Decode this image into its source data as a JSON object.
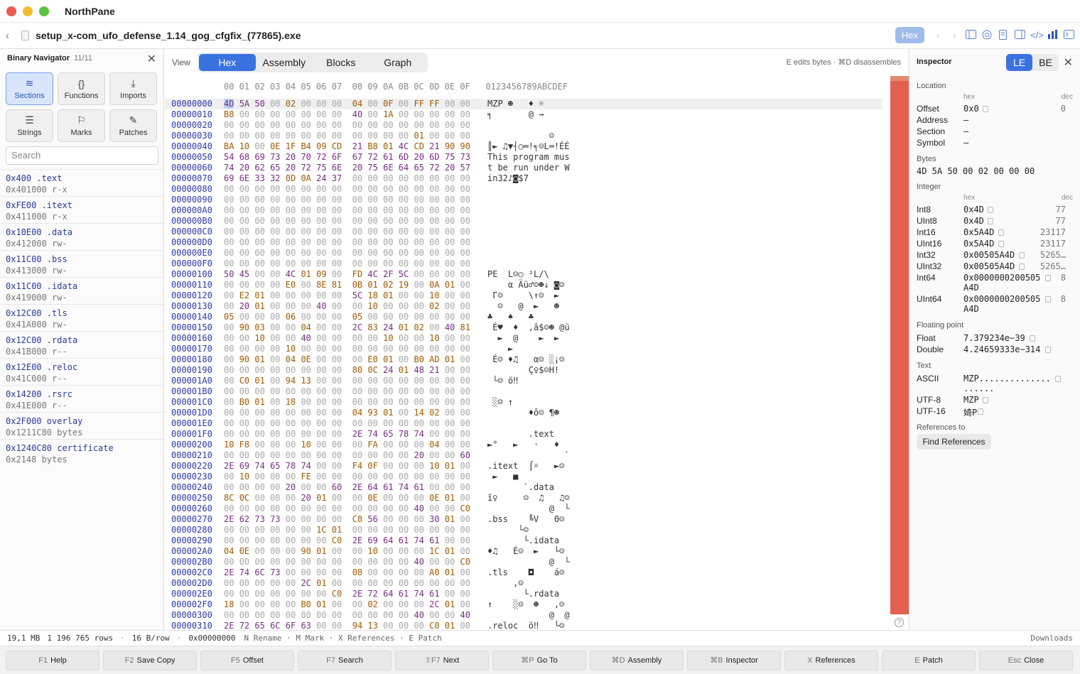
{
  "window": {
    "app_title": "NorthPane"
  },
  "pathbar": {
    "file_name": "setup_x-com_ufo_defense_1.14_gog_cfgfix_(77865).exe",
    "mode_pill": "Hex"
  },
  "sidebar": {
    "title": "Binary Navigator",
    "count": "11/11",
    "tiles": [
      {
        "label": "Sections",
        "icon": "layers-icon"
      },
      {
        "label": "Functions",
        "icon": "braces-icon"
      },
      {
        "label": "Imports",
        "icon": "import-icon"
      },
      {
        "label": "Strings",
        "icon": "strings-icon"
      },
      {
        "label": "Marks",
        "icon": "bookmark-icon"
      },
      {
        "label": "Patches",
        "icon": "patch-icon"
      }
    ],
    "search_placeholder": "Search",
    "sections": [
      {
        "name": "0x400 .text",
        "detail": "0x401000  r-x"
      },
      {
        "name": "0xFE00 .itext",
        "detail": "0x411000  r-x"
      },
      {
        "name": "0x10E00 .data",
        "detail": "0x412000  rw-"
      },
      {
        "name": "0x11C00 .bss",
        "detail": "0x413000  rw-"
      },
      {
        "name": "0x11C00 .idata",
        "detail": "0x419000  rw-"
      },
      {
        "name": "0x12C00 .tls",
        "detail": "0x41A000  rw-"
      },
      {
        "name": "0x12C00 .rdata",
        "detail": "0x41B000  r--"
      },
      {
        "name": "0x12E00 .reloc",
        "detail": "0x41C000  r--"
      },
      {
        "name": "0x14200 .rsrc",
        "detail": "0x41E000  r--"
      },
      {
        "name": "0x2F000 overlay",
        "detail": "0x1211C80 bytes"
      },
      {
        "name": "0x1240C80 certificate",
        "detail": "0x2148 bytes"
      }
    ]
  },
  "viewbar": {
    "label": "View",
    "tabs": [
      "Hex",
      "Assembly",
      "Blocks",
      "Graph"
    ],
    "hint": "E edits bytes · ⌘D disassembles"
  },
  "hex": {
    "header": "00 01 02 03 04 05 06 07  08 09 0A 0B 0C 0D 0E 0F   0123456789ABCDEF",
    "rows": [
      [
        "00000000",
        "4D 5A 50 00 02 00 00 00  04 00 0F 00 FF FF 00 00",
        "MZP ☻   ♦ ☼"
      ],
      [
        "00000010",
        "B8 00 00 00 00 00 00 00  40 00 1A 00 00 00 00 00",
        "╕       @ →"
      ],
      [
        "00000020",
        "00 00 00 00 00 00 00 00  00 00 00 00 00 00 00 00",
        ""
      ],
      [
        "00000030",
        "00 00 00 00 00 00 00 00  00 00 00 00 01 00 00 00",
        "            ☺"
      ],
      [
        "00000040",
        "BA 10 00 0E 1F B4 09 CD  21 B8 01 4C CD 21 90 90",
        "║► ♫▼┤○═!╕☺L═!ÉÉ"
      ],
      [
        "00000050",
        "54 68 69 73 20 70 72 6F  67 72 61 6D 20 6D 75 73",
        "This program mus"
      ],
      [
        "00000060",
        "74 20 62 65 20 72 75 6E  20 75 6E 64 65 72 20 57",
        "t be run under W"
      ],
      [
        "00000070",
        "69 6E 33 32 0D 0A 24 37  00 00 00 00 00 00 00 00",
        "in32♪◙$7"
      ],
      [
        "00000080",
        "00 00 00 00 00 00 00 00  00 00 00 00 00 00 00 00",
        ""
      ],
      [
        "00000090",
        "00 00 00 00 00 00 00 00  00 00 00 00 00 00 00 00",
        ""
      ],
      [
        "000000A0",
        "00 00 00 00 00 00 00 00  00 00 00 00 00 00 00 00",
        ""
      ],
      [
        "000000B0",
        "00 00 00 00 00 00 00 00  00 00 00 00 00 00 00 00",
        ""
      ],
      [
        "000000C0",
        "00 00 00 00 00 00 00 00  00 00 00 00 00 00 00 00",
        ""
      ],
      [
        "000000D0",
        "00 00 00 00 00 00 00 00  00 00 00 00 00 00 00 00",
        ""
      ],
      [
        "000000E0",
        "00 00 00 00 00 00 00 00  00 00 00 00 00 00 00 00",
        ""
      ],
      [
        "000000F0",
        "00 00 00 00 00 00 00 00  00 00 00 00 00 00 00 00",
        ""
      ],
      [
        "00000100",
        "50 45 00 00 4C 01 09 00  FD 4C 2F 5C 00 00 00 00",
        "PE  L☺○ ²L/\\"
      ],
      [
        "00000110",
        "00 00 00 00 E0 00 8E 81  0B 01 02 19 00 0A 01 00",
        "    α Äü♂☺☻↓ ◙☺"
      ],
      [
        "00000120",
        "00 E2 01 00 00 00 00 00  5C 18 01 00 00 10 00 00",
        " Γ☺     \\↑☺  ►"
      ],
      [
        "00000130",
        "00 20 01 00 00 00 40 00  00 10 00 00 00 02 00 00",
        "  ☺   @  ►   ☻"
      ],
      [
        "00000140",
        "05 00 00 00 06 00 00 00  05 00 00 00 00 00 00 00",
        "♣   ♠   ♣"
      ],
      [
        "00000150",
        "00 90 03 00 00 04 00 00  2C 83 24 01 02 00 40 81",
        " É♥  ♦  ,â$☺☻ @ü"
      ],
      [
        "00000160",
        "00 00 10 00 00 40 00 00  00 00 10 00 00 10 00 00",
        "  ►  @    ►  ►"
      ],
      [
        "00000170",
        "00 00 00 00 10 00 00 00  00 00 00 00 00 00 00 00",
        "    ►"
      ],
      [
        "00000180",
        "00 90 01 00 04 0E 00 00  00 E0 01 00 B0 AD 01 00",
        " É☺ ♦♫   α☺ ░¡☺"
      ],
      [
        "00000190",
        "00 00 00 00 00 00 00 00  80 0C 24 01 48 21 00 00",
        "        Ç♀$☺H!"
      ],
      [
        "000001A0",
        "00 C0 01 00 94 13 00 00  00 00 00 00 00 00 00 00",
        " └☺ ö‼"
      ],
      [
        "000001B0",
        "00 00 00 00 00 00 00 00  00 00 00 00 00 00 00 00",
        ""
      ],
      [
        "000001C0",
        "00 B0 01 00 18 00 00 00  00 00 00 00 00 00 00 00",
        " ░☺ ↑"
      ],
      [
        "000001D0",
        "00 00 00 00 00 00 00 00  04 93 01 00 14 02 00 00",
        "        ♦ô☺ ¶☻"
      ],
      [
        "000001E0",
        "00 00 00 00 00 00 00 00  00 00 00 00 00 00 00 00",
        ""
      ],
      [
        "000001F0",
        "00 00 00 00 00 00 00 00  2E 74 65 78 74 00 00 00",
        "        .text"
      ],
      [
        "00000200",
        "10 F8 00 00 00 10 00 00  00 FA 00 00 00 04 00 00",
        "►°   ►   ·   ♦"
      ],
      [
        "00000210",
        "00 00 00 00 00 00 00 00  00 00 00 00 20 00 00 60",
        "               `"
      ],
      [
        "00000220",
        "2E 69 74 65 78 74 00 00  F4 0F 00 00 00 10 01 00",
        ".itext  ⌠☼   ►☺"
      ],
      [
        "00000230",
        "00 10 00 00 00 FE 00 00  00 00 00 00 00 00 00 00",
        " ►   ■"
      ],
      [
        "00000240",
        "00 00 00 00 20 00 00 60  2E 64 61 74 61 00 00 00",
        "       `.data"
      ],
      [
        "00000250",
        "8C 0C 00 00 00 20 01 00  00 0E 00 00 00 0E 01 00",
        "î♀     ☺  ♫   ♫☺"
      ],
      [
        "00000260",
        "00 00 00 00 00 00 00 00  00 00 00 00 40 00 00 C0",
        "            @  └"
      ],
      [
        "00000270",
        "2E 62 73 73 00 00 00 00  C8 56 00 00 00 30 01 00",
        ".bss    ╚V   0☺"
      ],
      [
        "00000280",
        "00 00 00 00 00 00 1C 01  00 00 00 00 00 00 00 00",
        "      └☺"
      ],
      [
        "00000290",
        "00 00 00 00 00 00 00 C0  2E 69 64 61 74 61 00 00",
        "       └.idata"
      ],
      [
        "000002A0",
        "04 0E 00 00 00 90 01 00  00 10 00 00 00 1C 01 00",
        "♦♫   É☺  ►   └☺"
      ],
      [
        "000002B0",
        "00 00 00 00 00 00 00 00  00 00 00 00 40 00 00 C0",
        "            @  └"
      ],
      [
        "000002C0",
        "2E 74 6C 73 00 00 00 00  08 00 00 00 00 A0 01 00",
        ".tls    ◘    á☺"
      ],
      [
        "000002D0",
        "00 00 00 00 00 2C 01 00  00 00 00 00 00 00 00 00",
        "     ,☺"
      ],
      [
        "000002E0",
        "00 00 00 00 00 00 00 C0  2E 72 64 61 74 61 00 00",
        "       └.rdata"
      ],
      [
        "000002F0",
        "18 00 00 00 00 B0 01 00  00 02 00 00 00 2C 01 00",
        "↑    ░☺  ☻   ,☺"
      ],
      [
        "00000300",
        "00 00 00 00 00 00 00 00  00 00 00 00 40 00 00 40",
        "            @  @"
      ],
      [
        "00000310",
        "2E 72 65 6C 6F 63 00 00  94 13 00 00 00 C0 01 00",
        ".reloc  ö‼   └☺"
      ]
    ]
  },
  "inspector": {
    "title": "Inspector",
    "endian": [
      "LE",
      "BE"
    ],
    "location_title": "Location",
    "col_hex": "hex",
    "col_dec": "dec",
    "location": [
      {
        "k": "Offset",
        "v": "0x0",
        "d": "0"
      },
      {
        "k": "Address",
        "v": "—",
        "d": ""
      },
      {
        "k": "Section",
        "v": "—",
        "d": ""
      },
      {
        "k": "Symbol",
        "v": "—",
        "d": ""
      }
    ],
    "bytes_title": "Bytes",
    "bytes": "4D 5A 50 00 02 00 00 00",
    "integer_title": "Integer",
    "integers": [
      {
        "k": "Int8",
        "v": "0x4D",
        "d": "77"
      },
      {
        "k": "UInt8",
        "v": "0x4D",
        "d": "77"
      },
      {
        "k": "Int16",
        "v": "0x5A4D",
        "d": "23117"
      },
      {
        "k": "UInt16",
        "v": "0x5A4D",
        "d": "23117"
      },
      {
        "k": "Int32",
        "v": "0x00505A4D",
        "d": "5265…"
      },
      {
        "k": "UInt32",
        "v": "0x00505A4D",
        "d": "5265…"
      },
      {
        "k": "Int64",
        "v": "0x0000000200505",
        "v2": "A4D",
        "d": "8"
      },
      {
        "k": "UInt64",
        "v": "0x0000000200505",
        "v2": "A4D",
        "d": "8"
      }
    ],
    "float_title": "Floating point",
    "floats": [
      {
        "k": "Float",
        "v": "7.379234e−39"
      },
      {
        "k": "Double",
        "v": "4.24659333e−314"
      }
    ],
    "text_title": "Text",
    "texts": [
      {
        "k": "ASCII",
        "v": "MZP..............",
        "v2": "......"
      },
      {
        "k": "UTF-8",
        "v": "MZP"
      },
      {
        "k": "UTF-16",
        "v": "婍P"
      }
    ],
    "refs_title": "References to",
    "refs_button": "Find References"
  },
  "status": {
    "size": "19,1 MB",
    "rows": "1 196 765 rows",
    "bpr": "16 B/row",
    "offset": "0x00000000",
    "shortcuts": "N Rename · M Mark · X References · E Patch",
    "downloads": "Downloads"
  },
  "fnkeys": [
    {
      "key": "F1",
      "label": "Help"
    },
    {
      "key": "F2",
      "label": "Save Copy"
    },
    {
      "key": "F5",
      "label": "Offset"
    },
    {
      "key": "F7",
      "label": "Search"
    },
    {
      "key": "⇧F7",
      "label": "Next"
    },
    {
      "key": "⌘P",
      "label": "Go To"
    },
    {
      "key": "⌘D",
      "label": "Assembly"
    },
    {
      "key": "⌘B",
      "label": "Inspector"
    },
    {
      "key": "X",
      "label": "References"
    },
    {
      "key": "E",
      "label": "Patch"
    },
    {
      "key": "Esc",
      "label": "Close"
    }
  ],
  "colors": {
    "accent": "#3a72e0",
    "offset_text": "#2a3aa6",
    "byte_printable": "#7a2c86",
    "byte_control": "#a05a00",
    "byte_zero": "#a8a8a8",
    "minimap": "#e35f50"
  }
}
